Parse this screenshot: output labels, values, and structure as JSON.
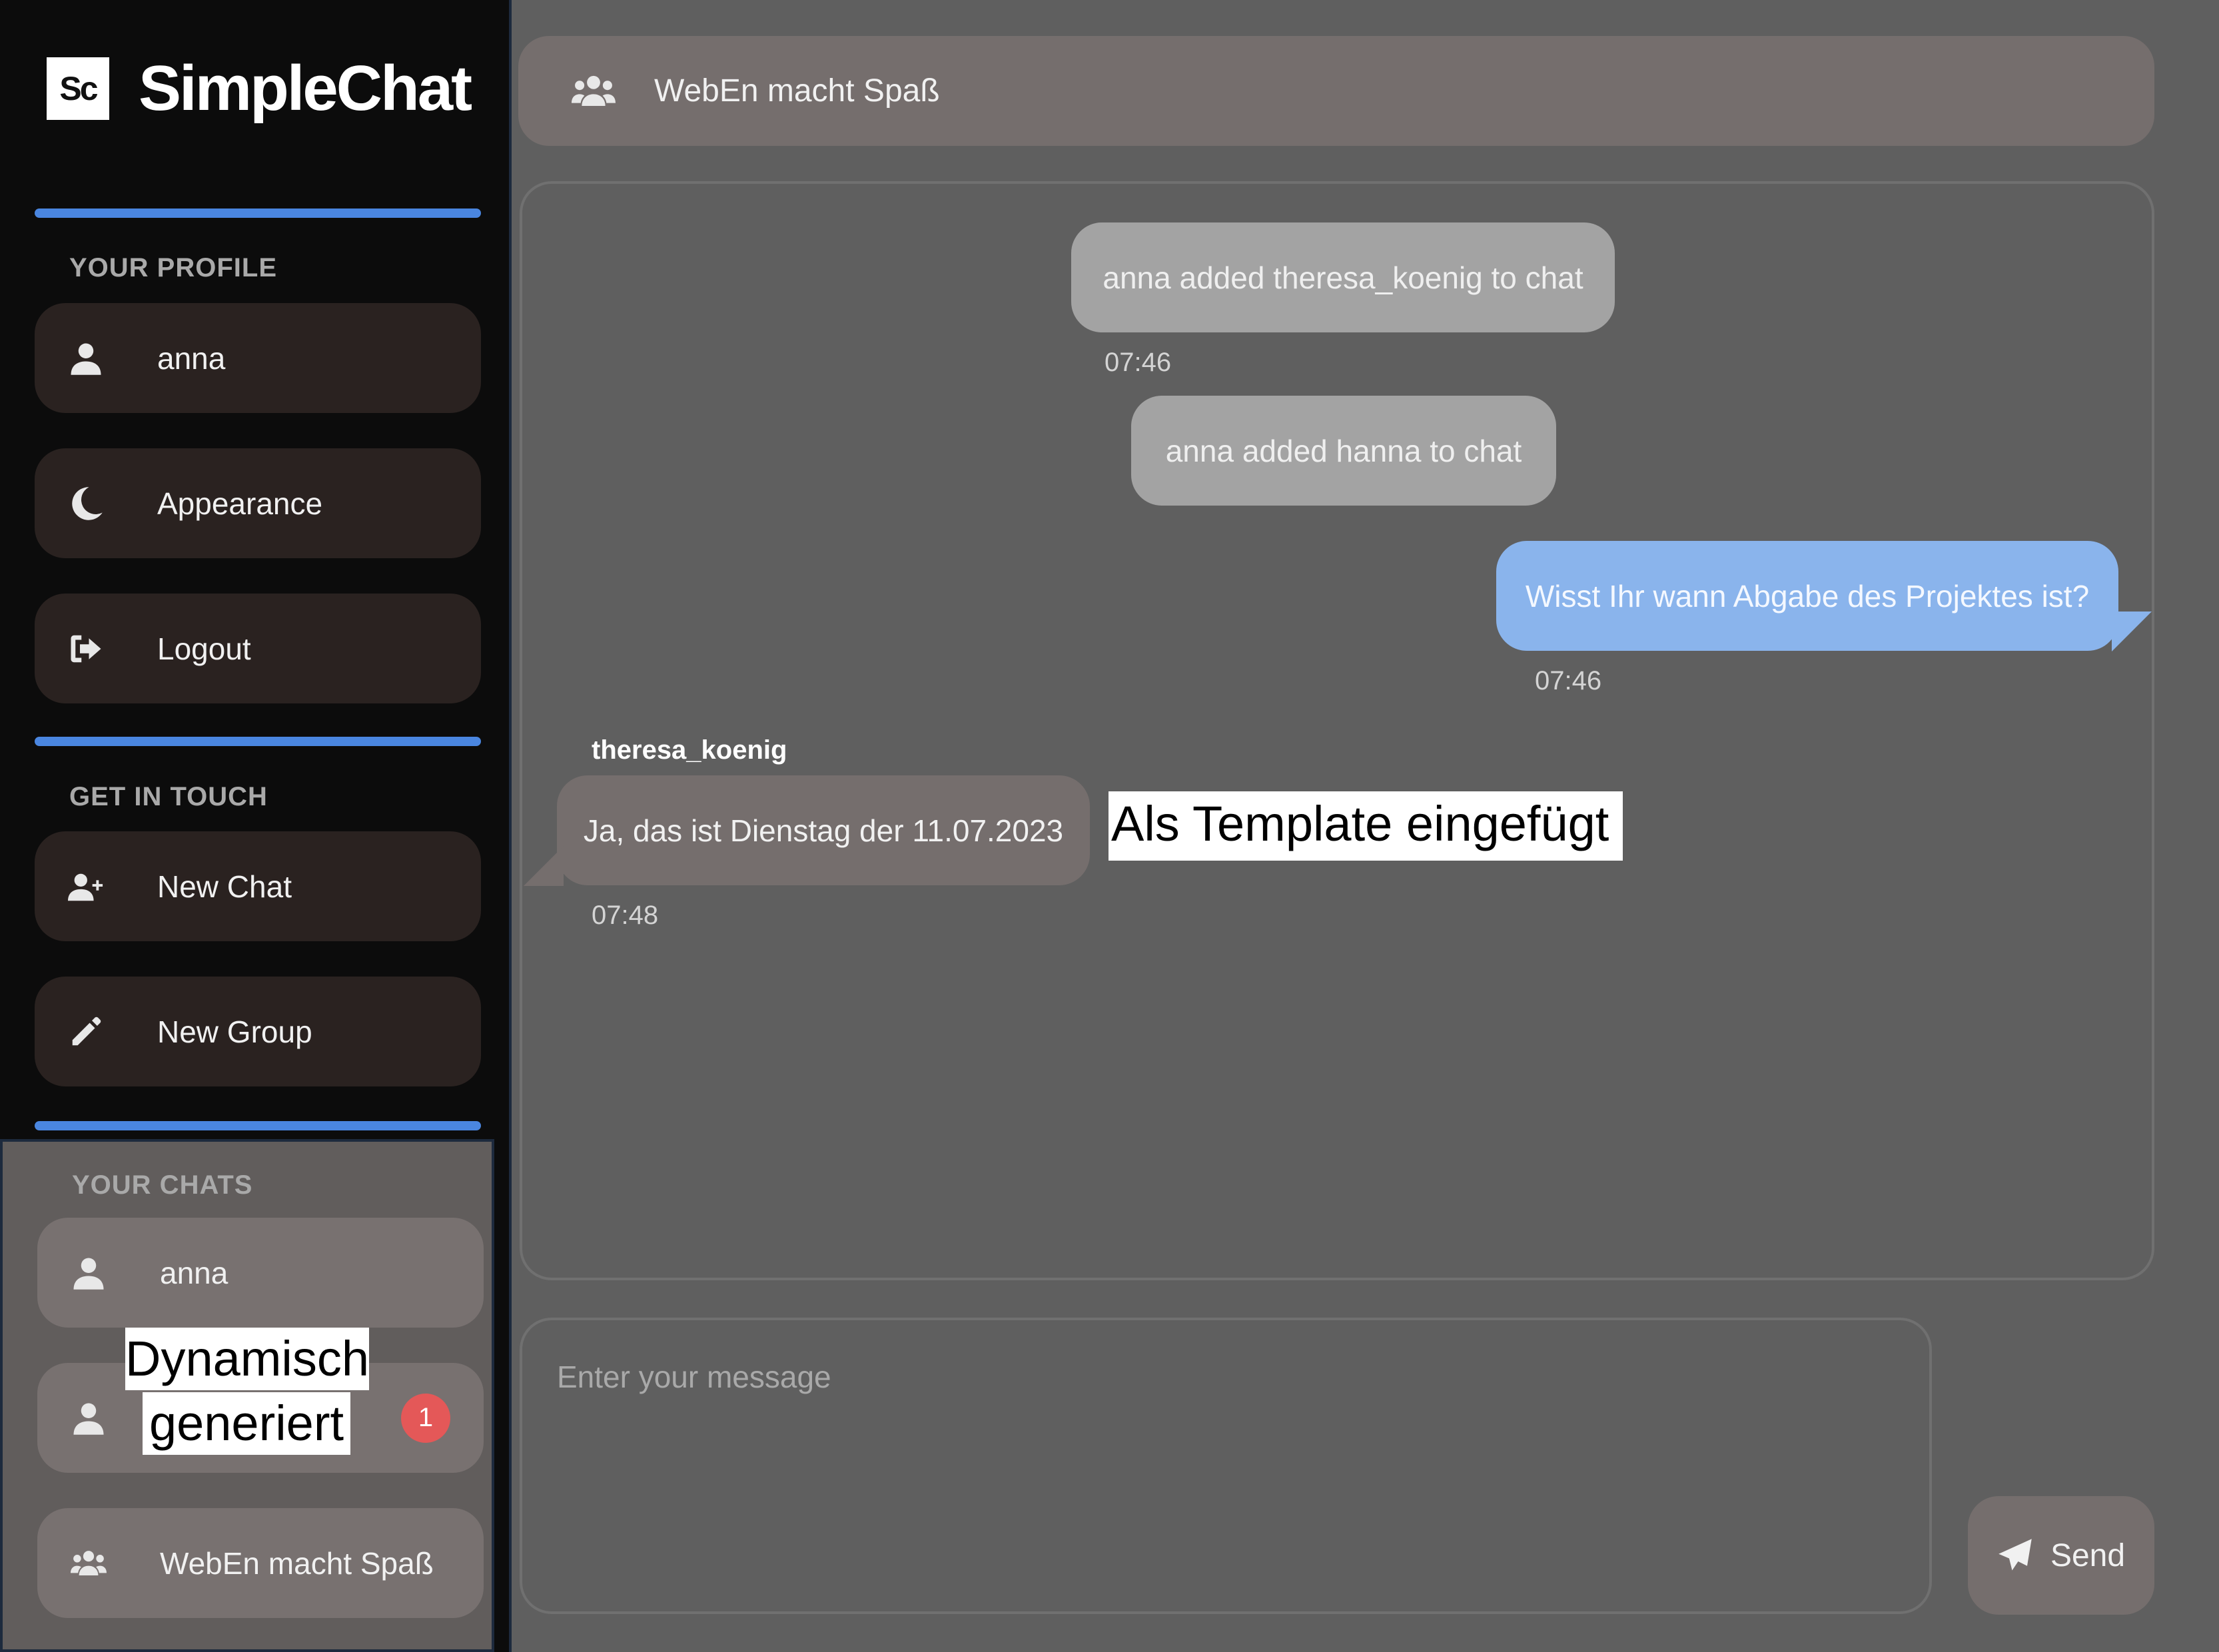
{
  "app": {
    "logo_abbr": "Sc",
    "title": "SimpleChat"
  },
  "sidebar": {
    "profile_label": "YOUR PROFILE",
    "profile_items": [
      {
        "label": "anna",
        "icon": "user-icon"
      },
      {
        "label": "Appearance",
        "icon": "moon-icon"
      },
      {
        "label": "Logout",
        "icon": "logout-icon"
      }
    ],
    "touch_label": "GET IN TOUCH",
    "touch_items": [
      {
        "label": "New Chat",
        "icon": "user-plus-icon"
      },
      {
        "label": "New Group",
        "icon": "pencil-icon"
      }
    ],
    "chats_label": "YOUR CHATS",
    "chats": [
      {
        "label": "anna",
        "icon": "user-icon"
      },
      {
        "label": "",
        "icon": "user-icon",
        "unread": "1"
      },
      {
        "label": "WebEn macht Spaß",
        "icon": "users-icon"
      }
    ],
    "annotation": [
      "Dynamisch",
      "generiert"
    ]
  },
  "chat": {
    "title": "WebEn macht Spaß",
    "messages": [
      {
        "type": "system",
        "text": "anna added theresa_koenig to chat",
        "time": "07:46"
      },
      {
        "type": "system",
        "text": "anna added hanna to chat",
        "time": ""
      },
      {
        "type": "own",
        "text": "Wisst Ihr wann Abgabe des Projektes ist?",
        "time": "07:46"
      },
      {
        "type": "other",
        "sender": "theresa_koenig",
        "text": "Ja, das ist Dienstag der 11.07.2023",
        "time": "07:48"
      }
    ],
    "annotation": "Als Template eingefügt",
    "input_placeholder": "Enter your message",
    "send_label": "Send"
  },
  "colors": {
    "accent": "#4a86e0",
    "own_bubble": "#8ab4ec",
    "badge": "#e45858",
    "sidebar_bg": "#0c0c0c",
    "main_bg": "#5f5f5f"
  }
}
